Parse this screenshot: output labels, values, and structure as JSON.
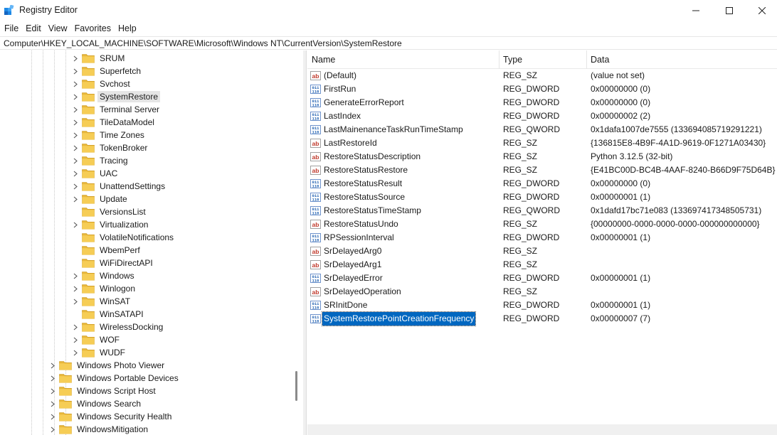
{
  "window": {
    "title": "Registry Editor",
    "icon": "registry-icon",
    "controls": [
      "minimize-icon",
      "maximize-icon",
      "close-icon"
    ]
  },
  "menu": [
    "File",
    "Edit",
    "View",
    "Favorites",
    "Help"
  ],
  "address": "Computer\\HKEY_LOCAL_MACHINE\\SOFTWARE\\Microsoft\\Windows NT\\CurrentVersion\\SystemRestore",
  "tree": {
    "inner_items": [
      {
        "label": "SRUM",
        "expandable": true,
        "selected": false
      },
      {
        "label": "Superfetch",
        "expandable": true,
        "selected": false
      },
      {
        "label": "Svchost",
        "expandable": true,
        "selected": false
      },
      {
        "label": "SystemRestore",
        "expandable": true,
        "selected": true
      },
      {
        "label": "Terminal Server",
        "expandable": true,
        "selected": false
      },
      {
        "label": "TileDataModel",
        "expandable": true,
        "selected": false
      },
      {
        "label": "Time Zones",
        "expandable": true,
        "selected": false
      },
      {
        "label": "TokenBroker",
        "expandable": true,
        "selected": false
      },
      {
        "label": "Tracing",
        "expandable": true,
        "selected": false
      },
      {
        "label": "UAC",
        "expandable": true,
        "selected": false
      },
      {
        "label": "UnattendSettings",
        "expandable": true,
        "selected": false
      },
      {
        "label": "Update",
        "expandable": true,
        "selected": false
      },
      {
        "label": "VersionsList",
        "expandable": false,
        "selected": false
      },
      {
        "label": "Virtualization",
        "expandable": true,
        "selected": false
      },
      {
        "label": "VolatileNotifications",
        "expandable": false,
        "selected": false
      },
      {
        "label": "WbemPerf",
        "expandable": false,
        "selected": false
      },
      {
        "label": "WiFiDirectAPI",
        "expandable": false,
        "selected": false
      },
      {
        "label": "Windows",
        "expandable": true,
        "selected": false
      },
      {
        "label": "Winlogon",
        "expandable": true,
        "selected": false
      },
      {
        "label": "WinSAT",
        "expandable": true,
        "selected": false
      },
      {
        "label": "WinSATAPI",
        "expandable": false,
        "selected": false
      },
      {
        "label": "WirelessDocking",
        "expandable": true,
        "selected": false
      },
      {
        "label": "WOF",
        "expandable": true,
        "selected": false
      },
      {
        "label": "WUDF",
        "expandable": true,
        "selected": false
      }
    ],
    "outer_items": [
      {
        "label": "Windows Photo Viewer",
        "expandable": true
      },
      {
        "label": "Windows Portable Devices",
        "expandable": true
      },
      {
        "label": "Windows Script Host",
        "expandable": true
      },
      {
        "label": "Windows Search",
        "expandable": true
      },
      {
        "label": "Windows Security Health",
        "expandable": true
      },
      {
        "label": "WindowsMitigation",
        "expandable": true
      }
    ]
  },
  "list": {
    "columns": {
      "name": "Name",
      "type": "Type",
      "data": "Data"
    },
    "rows": [
      {
        "icon": "string-value-icon",
        "name": "(Default)",
        "type": "REG_SZ",
        "data": "(value not set)",
        "selected": false
      },
      {
        "icon": "binary-value-icon",
        "name": "FirstRun",
        "type": "REG_DWORD",
        "data": "0x00000000 (0)",
        "selected": false
      },
      {
        "icon": "binary-value-icon",
        "name": "GenerateErrorReport",
        "type": "REG_DWORD",
        "data": "0x00000000 (0)",
        "selected": false
      },
      {
        "icon": "binary-value-icon",
        "name": "LastIndex",
        "type": "REG_DWORD",
        "data": "0x00000002 (2)",
        "selected": false
      },
      {
        "icon": "binary-value-icon",
        "name": "LastMainenanceTaskRunTimeStamp",
        "type": "REG_QWORD",
        "data": "0x1dafa1007de7555 (133694085719291221)",
        "selected": false
      },
      {
        "icon": "string-value-icon",
        "name": "LastRestoreId",
        "type": "REG_SZ",
        "data": "{136815E8-4B9F-4A1D-9619-0F1271A03430}",
        "selected": false
      },
      {
        "icon": "string-value-icon",
        "name": "RestoreStatusDescription",
        "type": "REG_SZ",
        "data": "Python 3.12.5 (32-bit)",
        "selected": false
      },
      {
        "icon": "string-value-icon",
        "name": "RestoreStatusRestore",
        "type": "REG_SZ",
        "data": "{E41BC00D-BC4B-4AAF-8240-B66D9F75D64B}",
        "selected": false
      },
      {
        "icon": "binary-value-icon",
        "name": "RestoreStatusResult",
        "type": "REG_DWORD",
        "data": "0x00000000 (0)",
        "selected": false
      },
      {
        "icon": "binary-value-icon",
        "name": "RestoreStatusSource",
        "type": "REG_DWORD",
        "data": "0x00000001 (1)",
        "selected": false
      },
      {
        "icon": "binary-value-icon",
        "name": "RestoreStatusTimeStamp",
        "type": "REG_QWORD",
        "data": "0x1dafd17bc71e083 (133697417348505731)",
        "selected": false
      },
      {
        "icon": "string-value-icon",
        "name": "RestoreStatusUndo",
        "type": "REG_SZ",
        "data": "{00000000-0000-0000-0000-000000000000}",
        "selected": false
      },
      {
        "icon": "binary-value-icon",
        "name": "RPSessionInterval",
        "type": "REG_DWORD",
        "data": "0x00000001 (1)",
        "selected": false
      },
      {
        "icon": "string-value-icon",
        "name": "SrDelayedArg0",
        "type": "REG_SZ",
        "data": "",
        "selected": false
      },
      {
        "icon": "string-value-icon",
        "name": "SrDelayedArg1",
        "type": "REG_SZ",
        "data": "",
        "selected": false
      },
      {
        "icon": "binary-value-icon",
        "name": "SrDelayedError",
        "type": "REG_DWORD",
        "data": "0x00000001 (1)",
        "selected": false
      },
      {
        "icon": "string-value-icon",
        "name": "SrDelayedOperation",
        "type": "REG_SZ",
        "data": "",
        "selected": false
      },
      {
        "icon": "binary-value-icon",
        "name": "SRInitDone",
        "type": "REG_DWORD",
        "data": "0x00000001 (1)",
        "selected": false
      },
      {
        "icon": "binary-value-icon",
        "name": "SystemRestorePointCreationFrequency",
        "type": "REG_DWORD",
        "data": "0x00000007 (7)",
        "selected": true
      }
    ]
  },
  "colors": {
    "folder": "#e8b73a",
    "selection": "#0067c0",
    "tree_selection": "#e5e5e5",
    "string_icon": "#c0392b",
    "binary_icon": "#1f5fb0"
  }
}
